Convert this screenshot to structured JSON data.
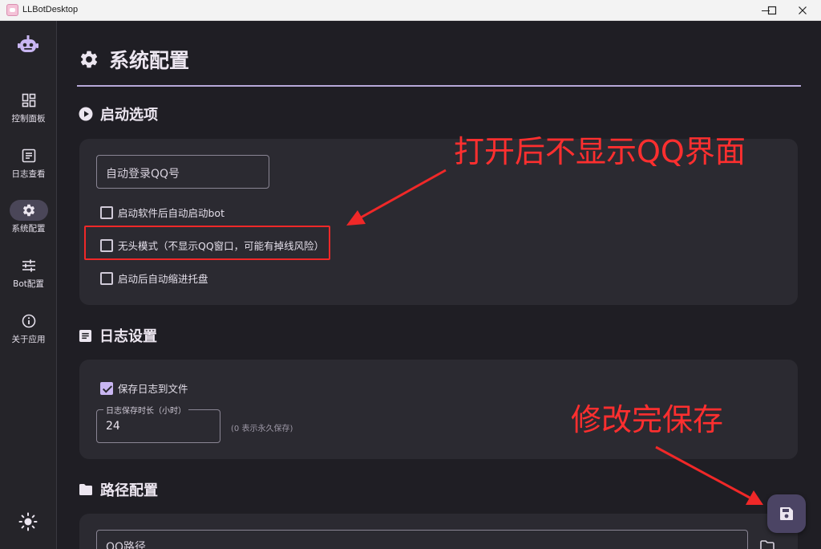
{
  "window": {
    "title": "LLBotDesktop",
    "controls": [
      "minimize-icon",
      "maximize-icon",
      "close-icon"
    ]
  },
  "sidebar": {
    "logo": "robot-icon",
    "items": [
      {
        "label": "控制面板",
        "icon": "dashboard-icon",
        "active": false
      },
      {
        "label": "日志查看",
        "icon": "log-icon",
        "active": false
      },
      {
        "label": "系统配置",
        "icon": "gear-icon",
        "active": true
      },
      {
        "label": "Bot配置",
        "icon": "sliders-icon",
        "active": false
      },
      {
        "label": "关于应用",
        "icon": "info-icon",
        "active": false
      }
    ],
    "theme_toggle_icon": "sun-icon"
  },
  "page": {
    "title": "系统配置",
    "title_icon": "gear-icon"
  },
  "startup": {
    "heading": "启动选项",
    "auto_login_placeholder": "自动登录QQ号",
    "options": [
      {
        "label": "启动软件后自动启动bot",
        "checked": false
      },
      {
        "label": "无头模式（不显示QQ窗口，可能有掉线风险）",
        "checked": false
      },
      {
        "label": "启动后自动缩进托盘",
        "checked": false
      }
    ]
  },
  "log": {
    "heading": "日志设置",
    "save_to_file_label": "保存日志到文件",
    "save_to_file_checked": true,
    "retention_label": "日志保存时长（小时）",
    "retention_value": "24",
    "retention_hint": "(0 表示永久保存)"
  },
  "paths": {
    "heading": "路径配置",
    "qq_path_label": "QQ路径"
  },
  "fab": {
    "icon": "save-icon"
  },
  "annotations": {
    "headless_note": "打开后不显示QQ界面",
    "save_note": "修改完保存",
    "color": "#ff2f2f"
  },
  "colors": {
    "accent": "#c9b6f2",
    "background": "#1f1e24",
    "card": "#2b2a31"
  }
}
